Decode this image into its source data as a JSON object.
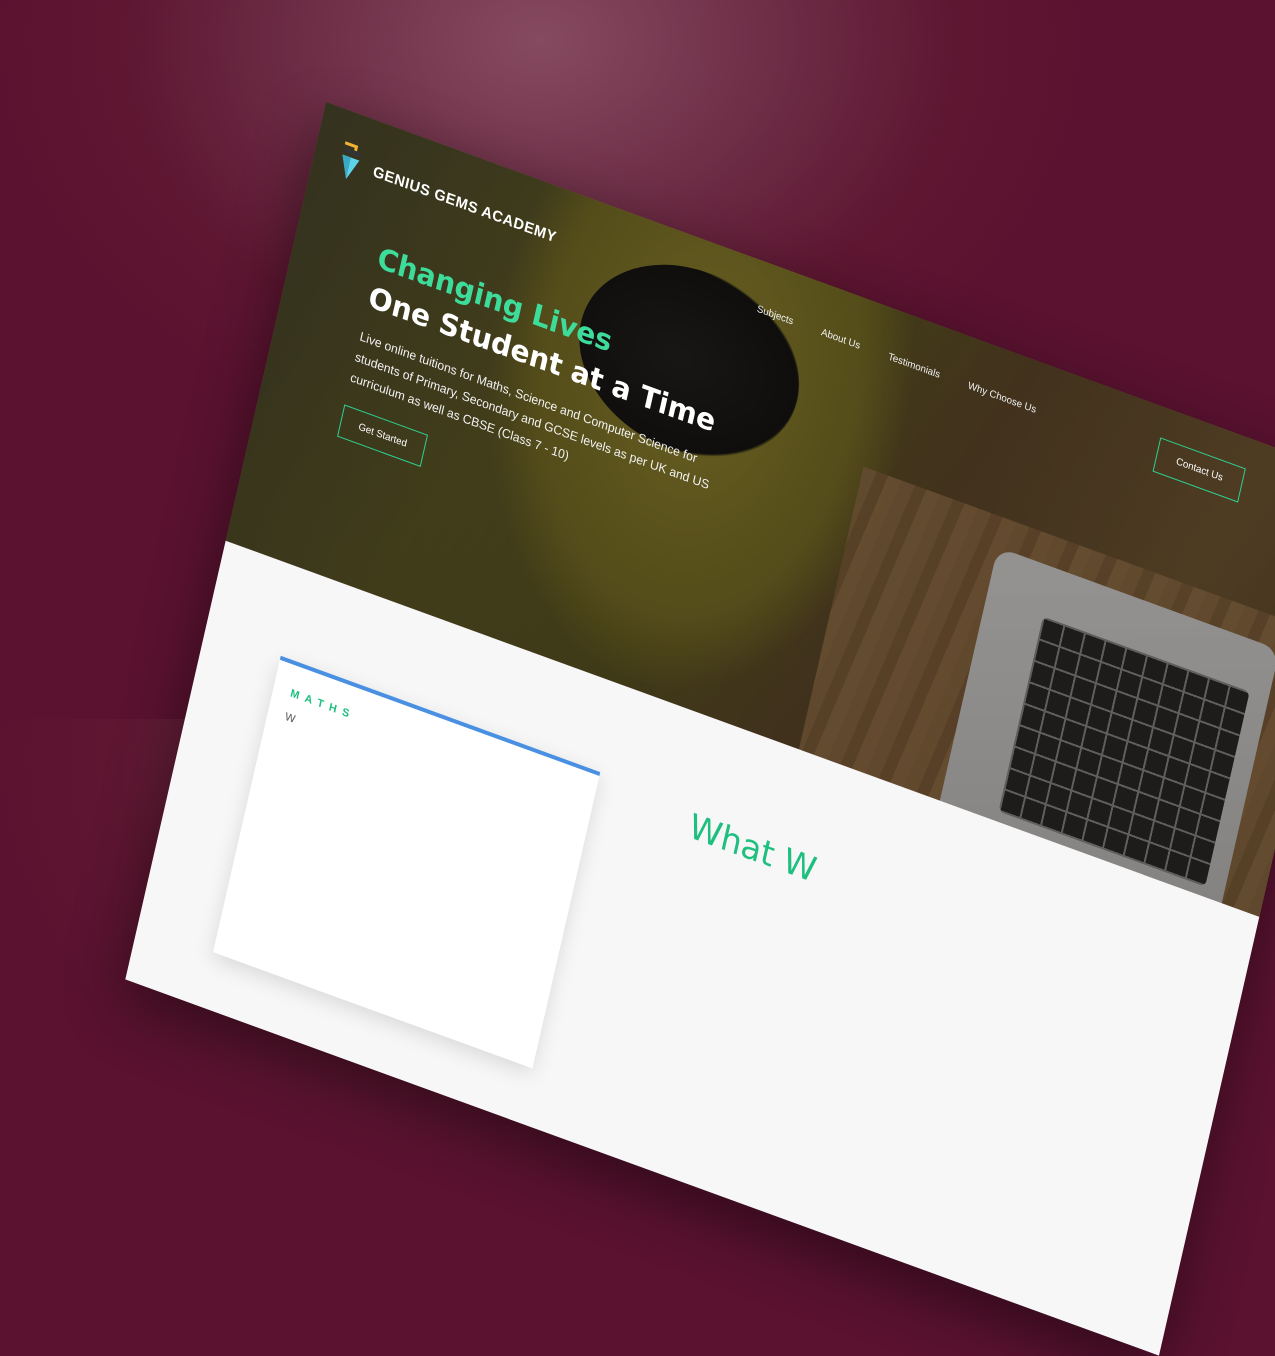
{
  "brand": {
    "name": "GENIUS GEMS ACADEMY",
    "icon": "gem-graduation-icon"
  },
  "nav": {
    "items": [
      "Subjects",
      "About Us",
      "Testimonials",
      "Why Choose Us"
    ],
    "contact_label": "Contact Us"
  },
  "hero": {
    "headline_accent": "Changing Lives",
    "headline_main": "One Student at a Time",
    "subtext": "Live online tuitions for Maths, Science and Computer Science for students of Primary, Secondary and GCSE levels as per UK and US curriculum as well as CBSE (Class 7 - 10)",
    "cta_label": "Get Started"
  },
  "section": {
    "heading": "What W",
    "card_title": "MATHS",
    "card_text": "W"
  },
  "colors": {
    "background": "#5e1631",
    "accent_green": "#3ddc9b",
    "card_border": "#4a90e2"
  }
}
